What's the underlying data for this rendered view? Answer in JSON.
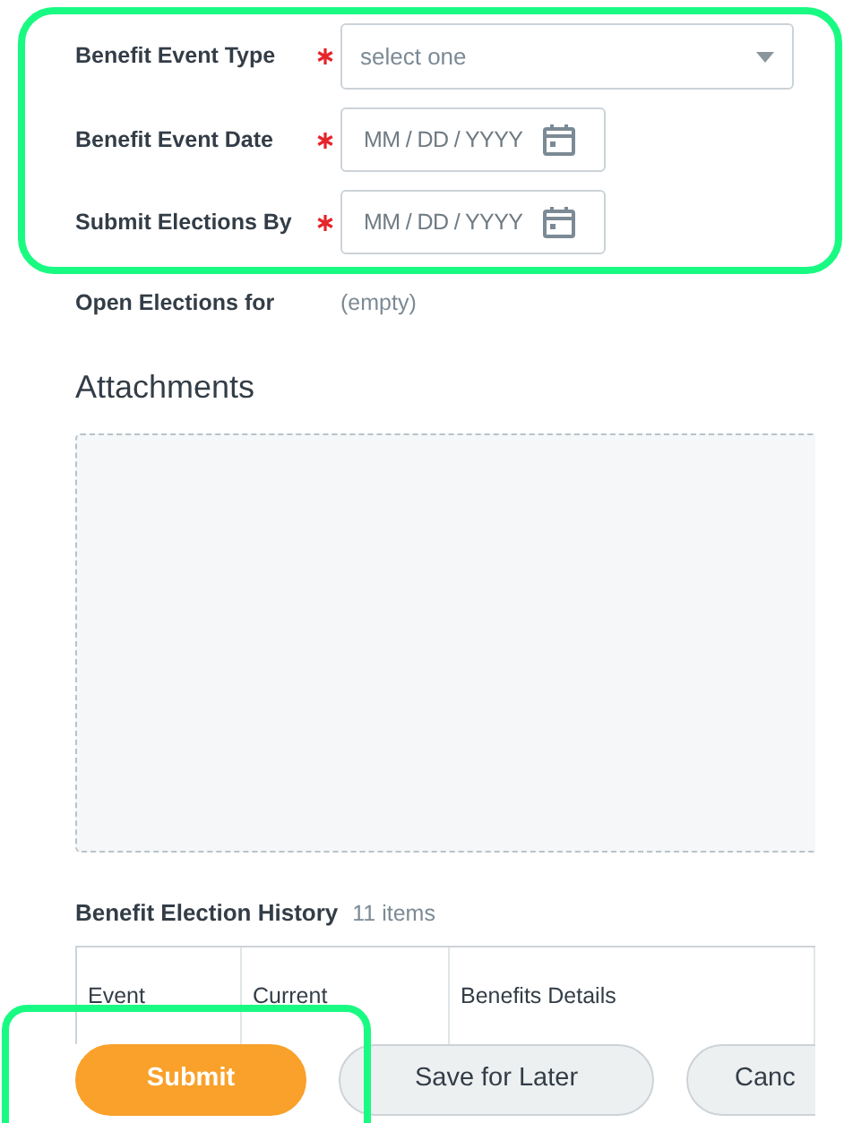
{
  "form": {
    "fields": [
      {
        "label": "Benefit Event Type",
        "required": true,
        "kind": "select",
        "placeholder": "select one"
      },
      {
        "label": "Benefit Event Date",
        "required": true,
        "kind": "date",
        "placeholder": "MM / DD / YYYY"
      },
      {
        "label": "Submit Elections By",
        "required": true,
        "kind": "date",
        "placeholder": "MM / DD / YYYY"
      }
    ]
  },
  "open_elections": {
    "label": "Open Elections for",
    "value": "(empty)"
  },
  "attachments": {
    "title": "Attachments"
  },
  "history": {
    "title": "Benefit Election History",
    "count": "11 items",
    "columns": [
      "Event",
      "Current",
      "Benefits Details"
    ]
  },
  "buttons": [
    {
      "label": "Submit",
      "kind": "primary"
    },
    {
      "label": "Save for Later",
      "kind": "secondary"
    },
    {
      "label": "Canc",
      "kind": "secondary"
    }
  ]
}
